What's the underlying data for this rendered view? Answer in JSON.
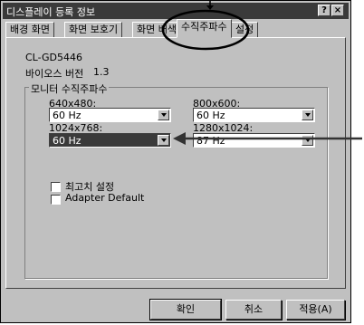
{
  "window": {
    "title": "디스플레이 등록 정보",
    "help_label": "?",
    "close_label": "×"
  },
  "tabs": [
    {
      "label": "배경 화면"
    },
    {
      "label": "화면 보호기"
    },
    {
      "label": "화면 배색"
    },
    {
      "label": "수직주파수"
    },
    {
      "label": "설정"
    }
  ],
  "adapter": {
    "name": "CL-GD5446",
    "bios_label": "바이오스 버전",
    "bios_value": "1.3"
  },
  "monitor_group": {
    "title": "모니터 수직주파수",
    "modes": [
      {
        "label": "640x480:",
        "value": "60 Hz"
      },
      {
        "label": "800x600:",
        "value": "60 Hz"
      },
      {
        "label": "1024x768:",
        "value": "60 Hz"
      },
      {
        "label": "1280x1024:",
        "value": "87 Hz"
      }
    ]
  },
  "options": {
    "optimal": "최고치 설정",
    "adapter_default": "Adapter Default"
  },
  "buttons": {
    "ok": "확인",
    "cancel": "취소",
    "apply": "적용(A)"
  },
  "colors": {
    "face": "#c0c0c0",
    "titlebar": "#3a3a3a",
    "highlight_select": "#3a3a3a"
  }
}
